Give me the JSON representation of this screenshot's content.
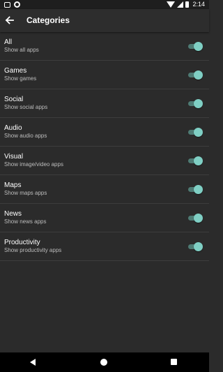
{
  "status_bar": {
    "time": "2:14"
  },
  "app_bar": {
    "title": "Categories",
    "back_icon": "arrow-back-icon"
  },
  "colors": {
    "background": "#2b2b2b",
    "app_bar": "#2d2d2d",
    "toggle_on_thumb": "#7fcfc4",
    "toggle_on_track": "#4e7b74",
    "divider": "#3d3d3d"
  },
  "categories": [
    {
      "title": "All",
      "subtitle": "Show all apps",
      "enabled": true
    },
    {
      "title": "Games",
      "subtitle": "Show games",
      "enabled": true
    },
    {
      "title": "Social",
      "subtitle": "Show social apps",
      "enabled": true
    },
    {
      "title": "Audio",
      "subtitle": "Show audio apps",
      "enabled": true
    },
    {
      "title": "Visual",
      "subtitle": "Show image/video apps",
      "enabled": true
    },
    {
      "title": "Maps",
      "subtitle": "Show maps apps",
      "enabled": true
    },
    {
      "title": "News",
      "subtitle": "Show news apps",
      "enabled": true
    },
    {
      "title": "Productivity",
      "subtitle": "Show productivity apps",
      "enabled": true
    }
  ]
}
